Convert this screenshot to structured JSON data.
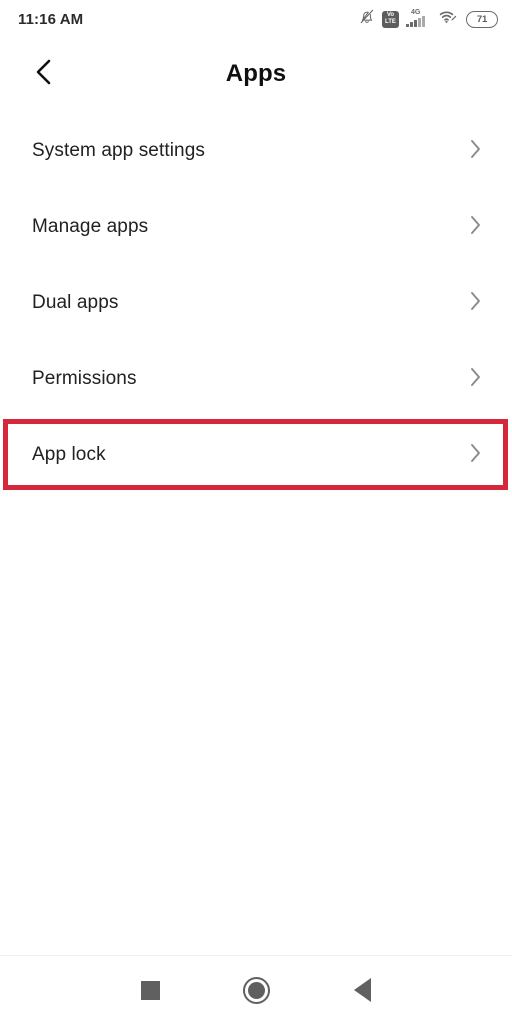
{
  "status_bar": {
    "time": "11:16 AM",
    "icons": [
      {
        "name": "bell-muted-icon",
        "label": "Silent"
      },
      {
        "name": "volte-icon",
        "line1": "Vo",
        "line2": "LTE"
      },
      {
        "name": "cellular-signal-icon",
        "network": "4G",
        "bars_total": 5,
        "bars_active": 3
      },
      {
        "name": "wifi-icon",
        "label": "Wi-Fi"
      },
      {
        "name": "battery-icon",
        "level": "71"
      }
    ]
  },
  "app_bar": {
    "back_icon": "chevron-left-icon",
    "title": "Apps"
  },
  "list": {
    "items": [
      {
        "label": "System app settings",
        "chevron": "chevron-right-icon",
        "highlighted": false
      },
      {
        "label": "Manage apps",
        "chevron": "chevron-right-icon",
        "highlighted": false
      },
      {
        "label": "Dual apps",
        "chevron": "chevron-right-icon",
        "highlighted": false
      },
      {
        "label": "Permissions",
        "chevron": "chevron-right-icon",
        "highlighted": false
      },
      {
        "label": "App lock",
        "chevron": "chevron-right-icon",
        "highlighted": true
      }
    ]
  },
  "annotation": {
    "target": "App lock",
    "color": "#d5293b"
  },
  "nav_bar": {
    "buttons": [
      {
        "name": "recents-button",
        "icon": "square-icon"
      },
      {
        "name": "home-button",
        "icon": "circle-icon"
      },
      {
        "name": "back-button",
        "icon": "triangle-left-icon"
      }
    ]
  },
  "colors": {
    "background": "#ffffff",
    "text_primary": "#212121",
    "text_secondary": "#6a6a6a",
    "chevron": "#8a8a8a",
    "accent_red": "#d5293b"
  }
}
